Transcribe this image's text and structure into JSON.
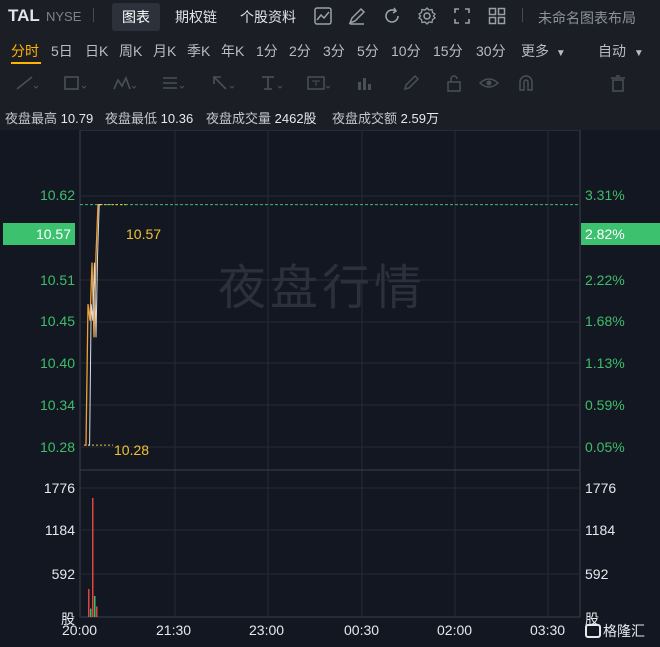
{
  "header": {
    "ticker": "TAL",
    "exchange": "NYSE",
    "menu": [
      "图表",
      "期权链",
      "个股资料"
    ],
    "active_menu": "图表",
    "layout_name": "未命名图表布局",
    "icons": [
      "line-chart-icon",
      "edit-icon",
      "refresh-icon",
      "settings-icon",
      "fullscreen-icon",
      "grid-layout-icon"
    ]
  },
  "period_tabs": {
    "items": [
      "分时",
      "5日",
      "日K",
      "周K",
      "月K",
      "季K",
      "年K",
      "1分",
      "2分",
      "3分",
      "5分",
      "10分",
      "15分",
      "30分"
    ],
    "active": "分时",
    "more_label": "更多",
    "scale_label": "自动"
  },
  "drawing_tools": [
    "trend-line-icon",
    "rectangle-icon",
    "pattern-icon",
    "fib-icon",
    "arrow-icon",
    "text-cursor-icon",
    "text-box-icon",
    "measure-icon",
    "pencil-icon",
    "lock-icon",
    "eye-icon",
    "magnet-icon",
    "trash-icon"
  ],
  "stats": {
    "high_label": "夜盘最高",
    "high": "10.79",
    "low_label": "夜盘最低",
    "low": "10.36",
    "volume_label": "夜盘成交量",
    "volume": "2462股",
    "amount_label": "夜盘成交额",
    "amount": "2.59万"
  },
  "chart": {
    "watermark": "夜盘行情",
    "price_labels": [
      "10.62",
      "10.51",
      "10.45",
      "10.40",
      "10.34",
      "10.28"
    ],
    "percent_labels": [
      "3.31%",
      "2.22%",
      "1.68%",
      "1.13%",
      "0.59%",
      "0.05%"
    ],
    "current_price": "10.57",
    "current_percent": "2.82%",
    "annotation_high": "10.57",
    "annotation_low": "10.28",
    "volume_labels": [
      "1776",
      "1184",
      "592"
    ],
    "volume_unit": "股",
    "time_labels": [
      "20:00",
      "21:30",
      "23:00",
      "00:30",
      "02:00",
      "03:30"
    ],
    "colors": {
      "up": "#3fbd6a",
      "line": "#f0a030",
      "accent": "#ffb400"
    }
  },
  "chart_data": {
    "type": "line",
    "x": [
      "20:00",
      "20:01",
      "20:02",
      "20:03",
      "20:04",
      "20:05",
      "20:06",
      "20:07",
      "20:08"
    ],
    "series": [
      {
        "values": [
          10.28,
          10.28,
          10.45,
          10.43,
          10.5,
          10.41,
          10.51,
          10.57,
          10.57
        ]
      }
    ],
    "ylim": [
      10.25,
      10.66
    ],
    "volume": [
      0,
      0,
      400,
      120,
      1700,
      300,
      150,
      0,
      0
    ],
    "volume_ylim": [
      0,
      2100
    ],
    "x_ticks": [
      "20:00",
      "21:30",
      "23:00",
      "00:30",
      "02:00",
      "03:30"
    ],
    "grid": true
  },
  "footer": {
    "brand": "格隆汇"
  }
}
